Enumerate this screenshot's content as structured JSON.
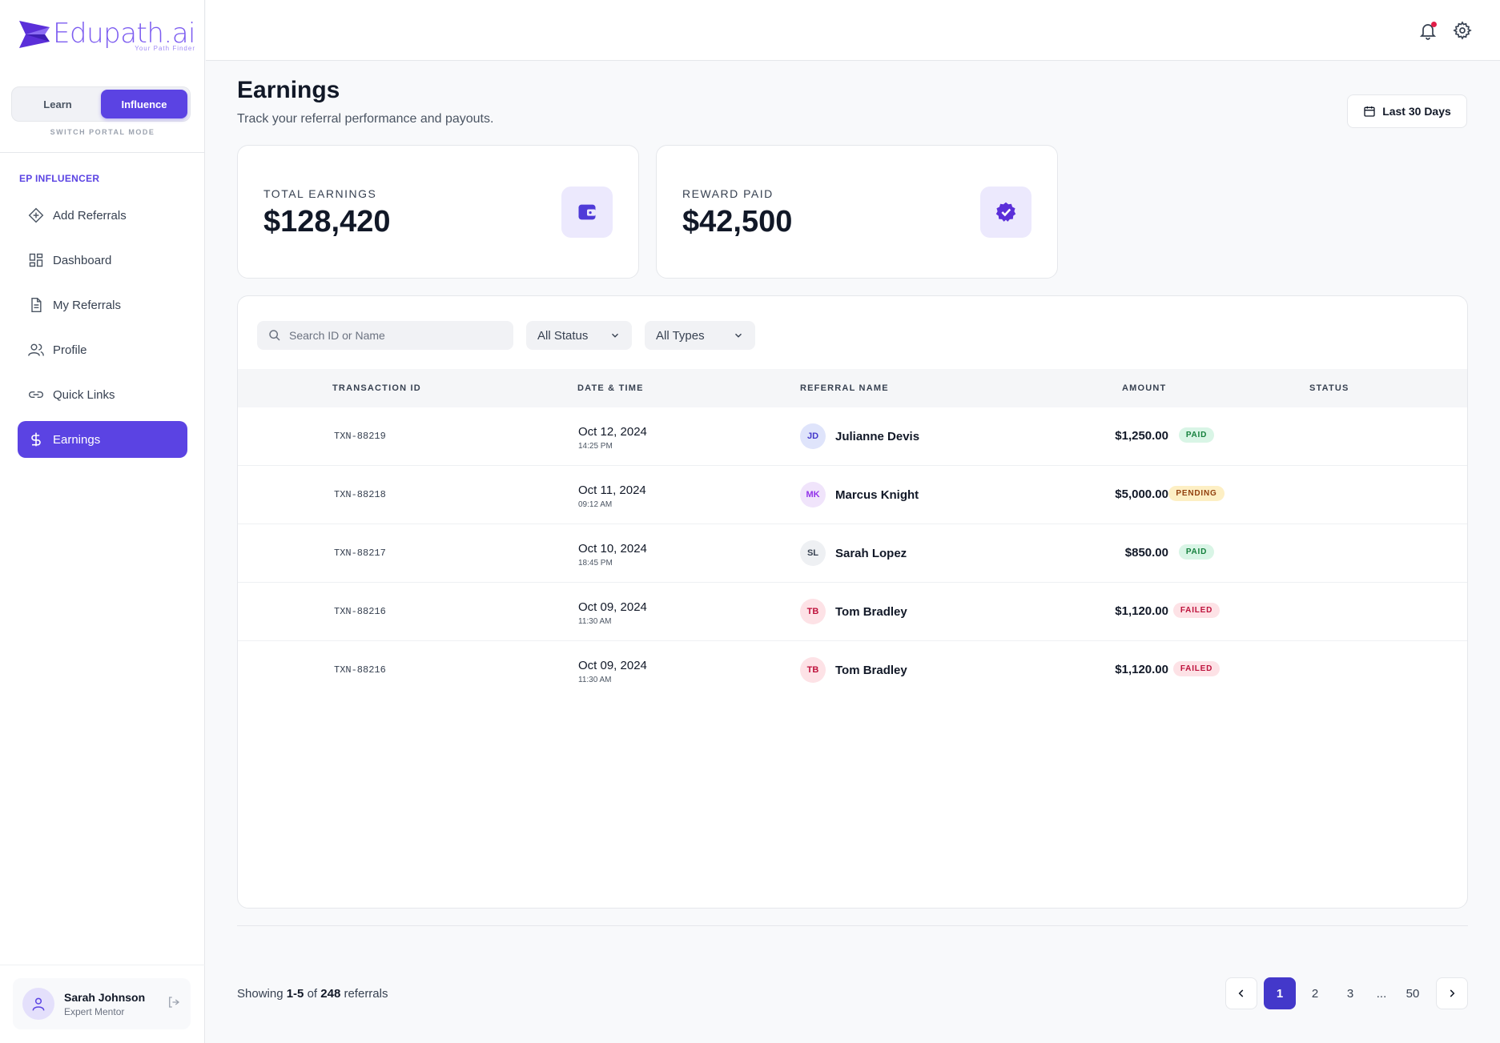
{
  "brand": {
    "name": "Edupath.ai",
    "tagline": "Your Path Finder",
    "accent": "#5b43e3"
  },
  "mode": {
    "options": [
      "Learn",
      "Influence"
    ],
    "selected": "Influence",
    "caption": "SWITCH PORTAL MODE"
  },
  "sidebar": {
    "section": "EP INFLUENCER",
    "items": [
      {
        "label": "Add Referrals",
        "icon": "diamond-plus-icon"
      },
      {
        "label": "Dashboard",
        "icon": "dashboard-grid-icon"
      },
      {
        "label": "My Referrals",
        "icon": "document-icon"
      },
      {
        "label": "Profile",
        "icon": "users-icon"
      },
      {
        "label": "Quick Links",
        "icon": "link-icon"
      },
      {
        "label": "Earnings",
        "icon": "dollar-icon",
        "active": true
      }
    ]
  },
  "user": {
    "name": "Sarah Johnson",
    "role": "Expert Mentor"
  },
  "header": {
    "title": "Earnings",
    "subtitle": "Track your referral performance and payouts.",
    "date_range": "Last 30 Days"
  },
  "stats": [
    {
      "label": "TOTAL EARNINGS",
      "value": "$128,420",
      "icon": "wallet-icon"
    },
    {
      "label": "REWARD PAID",
      "value": "$42,500",
      "icon": "verified-badge-icon"
    }
  ],
  "filters": {
    "search_placeholder": "Search ID or Name",
    "status": "All Status",
    "type": "All Types"
  },
  "table": {
    "columns": [
      "TRANSACTION ID",
      "DATE & TIME",
      "REFERRAL NAME",
      "AMOUNT",
      "STATUS"
    ],
    "rows": [
      {
        "id": "TXN-88219",
        "date": "Oct 12, 2024",
        "time": "14:25 PM",
        "initials": "JD",
        "name": "Julianne Devis",
        "amount": "$1,250.00",
        "status": "PAID"
      },
      {
        "id": "TXN-88218",
        "date": "Oct 11, 2024",
        "time": "09:12 AM",
        "initials": "MK",
        "name": "Marcus Knight",
        "amount": "$5,000.00",
        "status": "PENDING"
      },
      {
        "id": "TXN-88217",
        "date": "Oct 10, 2024",
        "time": "18:45 PM",
        "initials": "SL",
        "name": "Sarah Lopez",
        "amount": "$850.00",
        "status": "PAID"
      },
      {
        "id": "TXN-88216",
        "date": "Oct 09, 2024",
        "time": "11:30 AM",
        "initials": "TB",
        "name": "Tom Bradley",
        "amount": "$1,120.00",
        "status": "FAILED"
      },
      {
        "id": "TXN-88216",
        "date": "Oct 09, 2024",
        "time": "11:30 AM",
        "initials": "TB",
        "name": "Tom Bradley",
        "amount": "$1,120.00",
        "status": "FAILED"
      }
    ]
  },
  "pagination": {
    "showing_prefix": "Showing",
    "range": "1-5",
    "of": "of",
    "total": "248",
    "suffix": "referrals",
    "pages": [
      "1",
      "2",
      "3",
      "...",
      "50"
    ],
    "current": "1"
  }
}
